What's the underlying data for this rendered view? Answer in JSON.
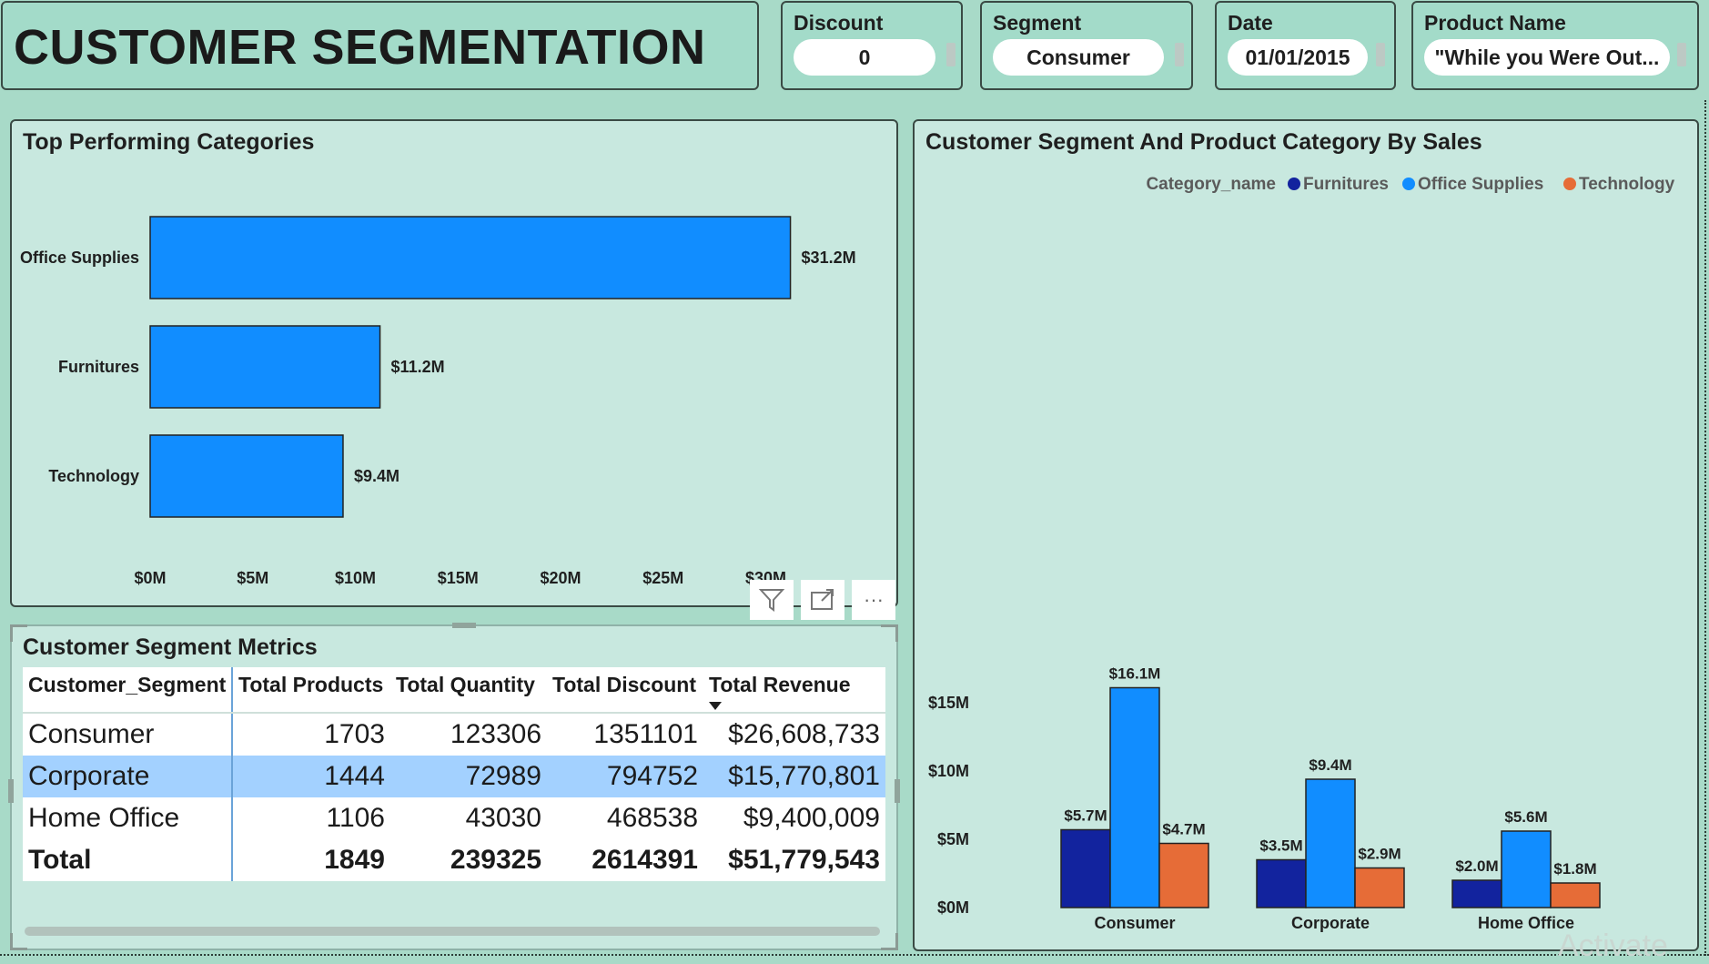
{
  "header": {
    "title": "CUSTOMER SEGMENTATION"
  },
  "slicers": {
    "discount": {
      "label": "Discount",
      "value": "0"
    },
    "segment": {
      "label": "Segment",
      "value": "Consumer"
    },
    "date": {
      "label": "Date",
      "value": "01/01/2015"
    },
    "product": {
      "label": "Product Name",
      "value": "\"While you Were Out..."
    }
  },
  "top_categories": {
    "title": "Top Performing Categories"
  },
  "segment_sales": {
    "title": "Customer Segment And Product Category By Sales",
    "legend_title": "Category_name"
  },
  "metrics": {
    "title": "Customer Segment Metrics",
    "columns": [
      "Customer_Segment",
      "Total Products",
      "Total Quantity",
      "Total Discount",
      "Total Revenue"
    ],
    "rows": [
      [
        "Consumer",
        "1703",
        "123306",
        "1351101",
        "$26,608,733"
      ],
      [
        "Corporate",
        "1444",
        "72989",
        "794752",
        "$15,770,801"
      ],
      [
        "Home Office",
        "1106",
        "43030",
        "468538",
        "$9,400,009"
      ]
    ],
    "total": [
      "Total",
      "1849",
      "239325",
      "2614391",
      "$51,779,543"
    ]
  },
  "toolbar": {
    "filter_icon": "filter-icon",
    "focus_icon": "focus-mode-icon",
    "more_icon": "more-options-icon",
    "more_label": "···"
  },
  "watermark": "Activate",
  "colors": {
    "furnitures": "#12239e",
    "office_supplies": "#118dff",
    "technology": "#e66c37",
    "background": "#a8dac8",
    "panel": "#c8e8df"
  },
  "chart_data": [
    {
      "type": "bar",
      "orientation": "horizontal",
      "title": "Top Performing Categories",
      "categories": [
        "Office Supplies",
        "Furnitures",
        "Technology"
      ],
      "values": [
        31.2,
        11.2,
        9.4
      ],
      "data_labels": [
        "$31.2M",
        "$11.2M",
        "$9.4M"
      ],
      "xticks": [
        "$0M",
        "$5M",
        "$10M",
        "$15M",
        "$20M",
        "$25M",
        "$30M"
      ],
      "xlim": [
        0,
        30
      ],
      "unit": "$M",
      "color": "#118dff",
      "grid": false
    },
    {
      "type": "bar",
      "title": "Customer Segment And Product Category By Sales",
      "categories": [
        "Consumer",
        "Corporate",
        "Home Office"
      ],
      "series": [
        {
          "name": "Furnitures",
          "values": [
            5.7,
            3.5,
            2.0
          ],
          "labels": [
            "$5.7M",
            "$3.5M",
            "$2.0M"
          ],
          "color": "#12239e"
        },
        {
          "name": "Office Supplies",
          "values": [
            16.1,
            9.4,
            5.6
          ],
          "labels": [
            "$16.1M",
            "$9.4M",
            "$5.6M"
          ],
          "color": "#118dff"
        },
        {
          "name": "Technology",
          "values": [
            4.7,
            2.9,
            1.8
          ],
          "labels": [
            "$4.7M",
            "$2.9M",
            "$1.8M"
          ],
          "color": "#e66c37"
        }
      ],
      "legend_title": "Category_name",
      "legend_position": "top-right",
      "yticks": [
        "$0M",
        "$5M",
        "$10M",
        "$15M"
      ],
      "ylim": [
        0,
        15
      ],
      "unit": "$M",
      "grid": false
    }
  ]
}
